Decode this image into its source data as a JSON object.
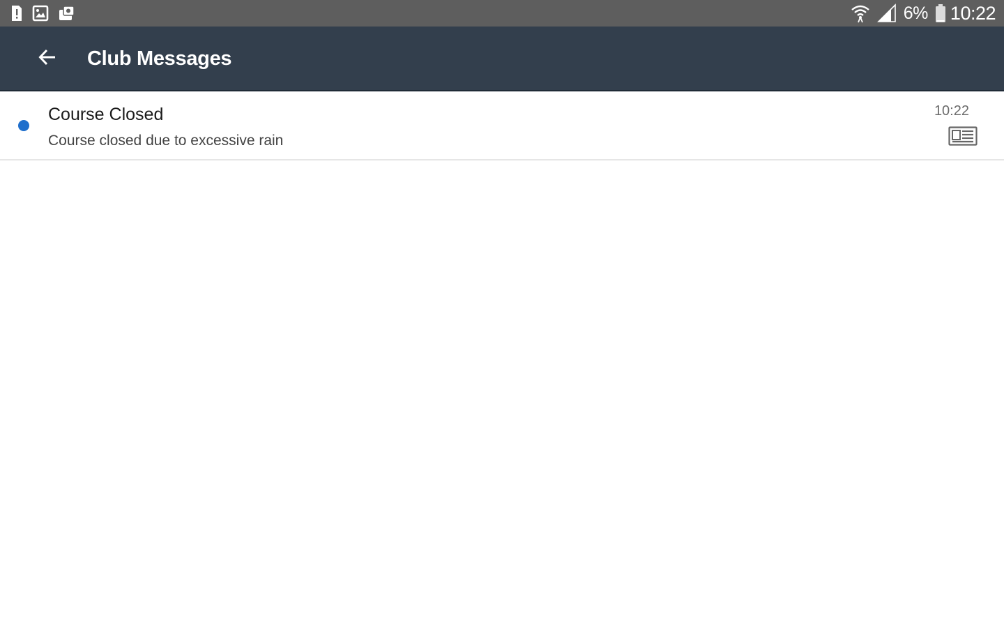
{
  "status_bar": {
    "left_icons": [
      "sim-alert-icon",
      "image-notification-icon",
      "app-notification-icon"
    ],
    "right_icons": [
      "wifi-icon",
      "signal-icon",
      "battery-icon"
    ],
    "battery_percent": "6%",
    "time": "10:22"
  },
  "app_bar": {
    "back_icon": "arrow-back-icon",
    "title": "Club Messages",
    "background_color": "#333f4d"
  },
  "messages": [
    {
      "title": "Course Closed",
      "preview": "Course closed due to excessive rain",
      "time": "10:22",
      "unread": true,
      "unread_color": "#1f6fcc",
      "type_icon": "newspaper-icon"
    }
  ]
}
